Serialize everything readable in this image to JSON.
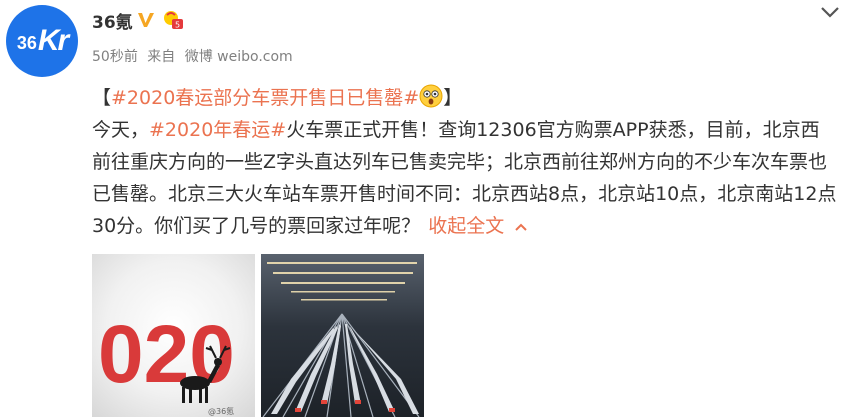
{
  "user": {
    "name": "36氪",
    "avatar_text": [
      "36",
      "Kr"
    ]
  },
  "meta": {
    "time": "50秒前",
    "source_label": "来自",
    "source": "微博 weibo.com"
  },
  "post": {
    "open_bracket": "【",
    "title_tag": "#2020春运部分车票开售日已售罄#",
    "close_bracket": "】",
    "text_before_tag": "今天，",
    "inline_tag": "#2020年春运#",
    "text_after_tag": "火车票正式开售！查询12306官方购票APP获悉，目前，北京西前往重庆方向的一些Z字头直达列车已售卖完毕；北京西前往郑州方向的不少车次车票也已售罄。北京三大火车站车票开售时间不同：北京西站8点，北京站10点，北京南站12点30分。你们买了几号的票回家过年呢？",
    "collapse_label": "收起全文"
  },
  "images": [
    {
      "description_text": "020",
      "watermark": "@36氪"
    },
    {
      "description_text": ""
    }
  ],
  "colors": {
    "accent": "#eb7350",
    "avatar": "#1e73e8",
    "verify": "#f5a623"
  },
  "icons": [
    "verify-badge-icon",
    "level-badge-icon",
    "chevron-down-icon",
    "shocked-emoji-icon",
    "collapse-chevron-icon"
  ]
}
